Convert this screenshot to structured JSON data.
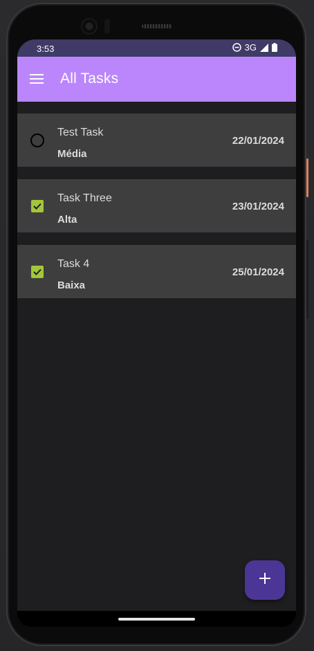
{
  "status_bar": {
    "time": "3:53",
    "network": "3G",
    "icons": [
      "do-not-disturb-icon",
      "signal-icon",
      "battery-icon"
    ]
  },
  "app_bar": {
    "title": "All Tasks",
    "menu_icon": "menu-icon",
    "color": "#bb86fc"
  },
  "tasks": [
    {
      "title": "Test Task",
      "priority": "Média",
      "date": "22/01/2024",
      "completed": false
    },
    {
      "title": "Task Three",
      "priority": "Alta",
      "date": "23/01/2024",
      "completed": true
    },
    {
      "title": "Task 4",
      "priority": "Baixa",
      "date": "25/01/2024",
      "completed": true
    }
  ],
  "fab": {
    "icon": "plus-icon",
    "color": "#4b3696"
  },
  "colors": {
    "status_bar": "#403a66",
    "background": "#1e1e21",
    "card": "#3e3e3e",
    "check": "#a4c639"
  }
}
